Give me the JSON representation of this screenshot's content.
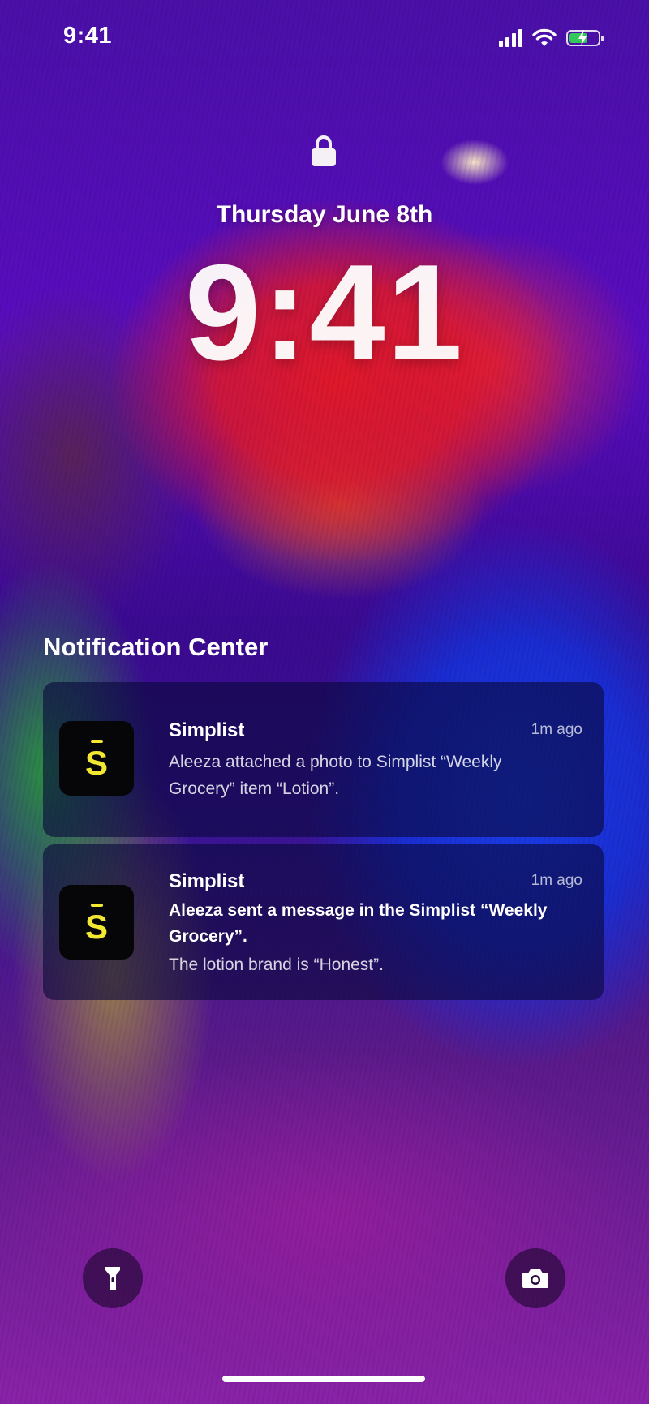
{
  "status_bar": {
    "time": "9:41",
    "icons": [
      "cellular-signal-icon",
      "wifi-icon",
      "battery-charging-icon"
    ]
  },
  "lock_screen": {
    "lock_icon": "lock-icon",
    "date": "Thursday June 8th",
    "time": "9:41"
  },
  "notification_center": {
    "title": "Notification Center",
    "notifications": [
      {
        "app_name": "Simplist",
        "app_icon_letter": "S",
        "time_ago": "1m ago",
        "bold_text": "",
        "message": "Aleeza attached a photo to Simplist “Weekly Grocery” item “Lotion”."
      },
      {
        "app_name": "Simplist",
        "app_icon_letter": "S",
        "time_ago": "1m ago",
        "bold_text": "Aleeza sent a message in the Simplist “Weekly Grocery”.",
        "message": "The lotion brand is “Honest”."
      }
    ]
  },
  "bottom_controls": {
    "left": "flashlight-icon",
    "right": "camera-icon"
  },
  "colors": {
    "app_icon_accent": "#f2e832",
    "app_icon_background": "#060608",
    "battery_green": "#34c759"
  }
}
